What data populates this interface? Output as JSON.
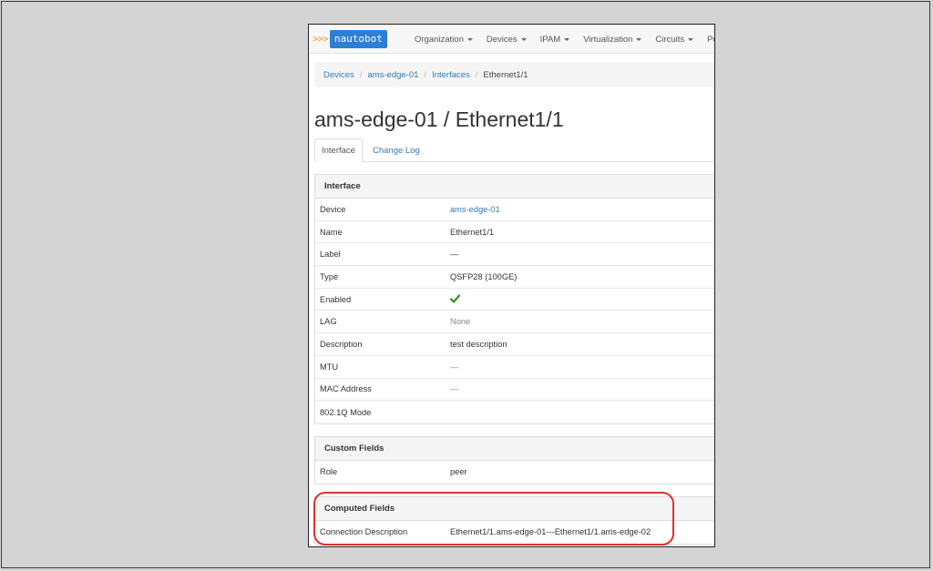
{
  "brand": {
    "chevrons": ">>>",
    "name": "nautobot"
  },
  "nav": {
    "items": [
      {
        "label": "Organization"
      },
      {
        "label": "Devices"
      },
      {
        "label": "IPAM"
      },
      {
        "label": "Virtualization"
      },
      {
        "label": "Circuits"
      },
      {
        "label": "Po"
      }
    ]
  },
  "breadcrumb": {
    "items": [
      "Devices",
      "ams-edge-01",
      "Interfaces"
    ],
    "active": "Ethernet1/1",
    "separator": "/"
  },
  "page": {
    "title": "ams-edge-01 / Ethernet1/1"
  },
  "tabs": {
    "active": "Interface",
    "other": "Change Log"
  },
  "interface_panel": {
    "heading": "Interface",
    "rows": [
      {
        "label": "Device",
        "value": "ams-edge-01"
      },
      {
        "label": "Name",
        "value": "Ethernet1/1"
      },
      {
        "label": "Label",
        "value": "—"
      },
      {
        "label": "Type",
        "value": "QSFP28 (100GE)"
      },
      {
        "label": "Enabled",
        "value": "✔"
      },
      {
        "label": "LAG",
        "value": "None"
      },
      {
        "label": "Description",
        "value": "test description"
      },
      {
        "label": "MTU",
        "value": "—"
      },
      {
        "label": "MAC Address",
        "value": "—"
      },
      {
        "label": "802.1Q Mode",
        "value": ""
      }
    ]
  },
  "custom_fields_panel": {
    "heading": "Custom Fields",
    "rows": [
      {
        "label": "Role",
        "value": "peer"
      }
    ]
  },
  "computed_fields_panel": {
    "heading": "Computed Fields",
    "rows": [
      {
        "label": "Connection Description",
        "value": "Ethernet1/1.ams-edge-01---Ethernet1/1.ams-edge-02"
      }
    ]
  },
  "colors": {
    "link": "#337ab7",
    "brand": "#2c7fd6",
    "brand_chevrons": "#f0a030",
    "highlight": "#d9342b",
    "check": "#3c8a2e"
  },
  "icons": {
    "enabled": "check-icon",
    "dropdown": "caret-down-icon"
  }
}
